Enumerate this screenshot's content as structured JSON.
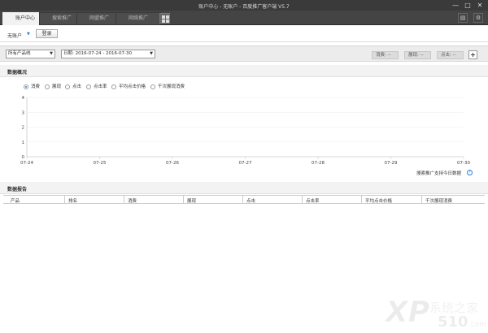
{
  "window": {
    "title": "账户中心 - 无账户 - 百度推广客户端 V5.7",
    "controls": {
      "minimize": "—",
      "maximize": "□",
      "close": "✕"
    }
  },
  "tabs": [
    {
      "label": "账户中心",
      "active": true
    },
    {
      "label": "搜索推广",
      "active": false
    },
    {
      "label": "网盟推广",
      "active": false
    },
    {
      "label": "网络推广",
      "active": false
    }
  ],
  "toolbar": {
    "icons": [
      "grid-icon",
      "message-icon",
      "gear-icon"
    ]
  },
  "account": {
    "name": "无账户",
    "login_label": "登录"
  },
  "filters": {
    "product_line": "所有产品线",
    "date_range": "日期: 2016-07-24 - 2016-07-30",
    "pills": [
      "消费: --",
      "展现: --",
      "点击: --"
    ],
    "add_label": "+"
  },
  "overview": {
    "title": "数据概况",
    "metrics": [
      {
        "label": "消费",
        "selected": true
      },
      {
        "label": "展现",
        "selected": false
      },
      {
        "label": "点击",
        "selected": false
      },
      {
        "label": "点击率",
        "selected": false
      },
      {
        "label": "平均点击价格",
        "selected": false
      },
      {
        "label": "千次展现消费",
        "selected": false
      }
    ],
    "note": "搜索推广支持今日数据",
    "help": "?"
  },
  "chart_data": {
    "type": "line",
    "x": [
      "07-24",
      "07-25",
      "07-26",
      "07-27",
      "07-28",
      "07-29",
      "07-30"
    ],
    "yticks": [
      0,
      1,
      2,
      3,
      4
    ],
    "ylim": [
      0,
      4
    ],
    "series": [],
    "grid": true,
    "colors": {
      "axis": "#cccccc",
      "grid": "#eeeeee"
    }
  },
  "report": {
    "title": "数据报告",
    "columns": [
      "产品",
      "排名",
      "消费",
      "展现",
      "点击",
      "点击率",
      "平均点击价格",
      "千次展现消费"
    ],
    "rows": []
  },
  "watermark": {
    "line1": "XP",
    "line2": "510",
    "line3": "系统之家",
    "line4": ".com"
  },
  "colors": {
    "accent": "#2b7fd6",
    "titlebar": "#3a3a3a"
  }
}
